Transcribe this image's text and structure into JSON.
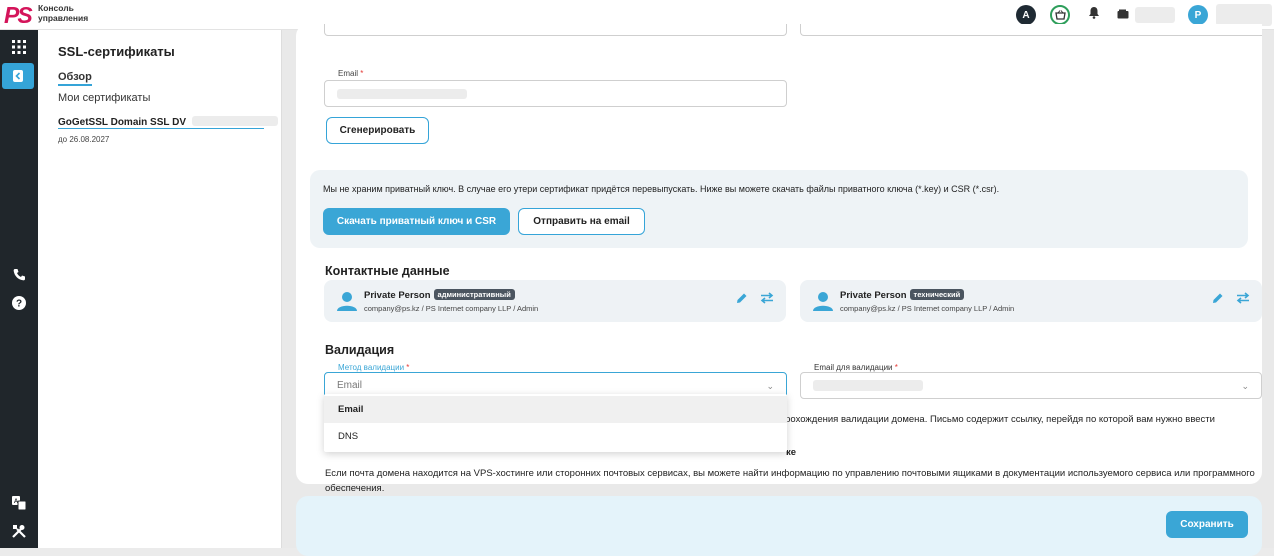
{
  "topbar": {
    "logo": "PS",
    "logo_text_line1": "Консоль",
    "logo_text_line2": "управления",
    "avatar_a": "A",
    "avatar_p": "P"
  },
  "sidebar": {
    "title": "SSL-сертификаты",
    "items": [
      {
        "label": "Обзор",
        "active": true
      },
      {
        "label": "Мои сертификаты",
        "active": false
      }
    ],
    "certificate": {
      "name": "GoGetSSL Domain SSL DV",
      "expires": "до 26.08.2027"
    }
  },
  "form": {
    "email_label": "Email",
    "generate_button": "Сгенерировать"
  },
  "private_key": {
    "notice": "Мы не храним приватный ключ. В случае его утери сертификат придётся перевыпускать. Ниже вы можете скачать файлы приватного ключа (*.key) и CSR (*.csr).",
    "download_button": "Скачать приватный ключ и CSR",
    "send_email_button": "Отправить на email"
  },
  "contacts": {
    "title": "Контактные данные",
    "items": [
      {
        "name": "Private Person",
        "role": "административный",
        "details": "company@ps.kz / PS Internet company LLP / Admin"
      },
      {
        "name": "Private Person",
        "role": "технический",
        "details": "company@ps.kz / PS Internet company LLP / Admin"
      }
    ]
  },
  "validation": {
    "title": "Валидация",
    "method_label": "Метод валидации",
    "method_value": "Email",
    "email_label": "Email для валидации",
    "options": [
      "Email",
      "DNS"
    ],
    "text_partial": "прохождения валидации домена. Письмо содержит ссылку, перейдя по которой вам нужно ввести",
    "link_partial": "ке",
    "paragraph2": "Если почта домена находится на VPS-хостинге или сторонних почтовых сервисах, вы можете найти информацию по управлению почтовыми ящиками в документации используемого сервиса или программного обеспечения."
  },
  "footer": {
    "save_button": "Сохранить"
  },
  "colors": {
    "accent": "#3aa6d6",
    "brand": "#d4145a",
    "rail": "#20262b"
  }
}
